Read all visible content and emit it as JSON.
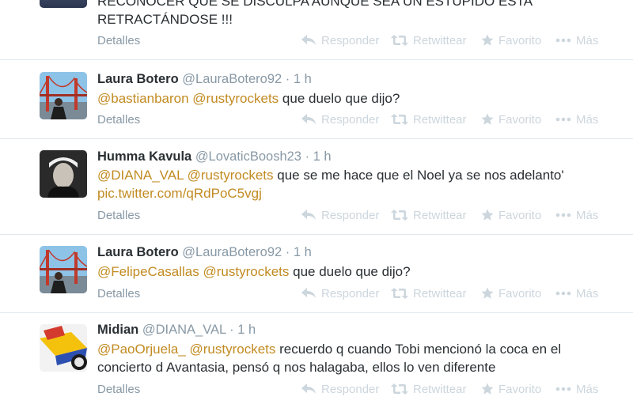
{
  "colors": {
    "mention": "#c28b22",
    "muted": "#8899a6",
    "action": "#ccd6dd",
    "divider": "#e1e8ed"
  },
  "actions": {
    "reply": "Responder",
    "retweet": "Retwittear",
    "favorite": "Favorito",
    "more": "Más",
    "details": "Detalles"
  },
  "tweets": [
    {
      "text_line1": "RECONOCER QUE SE DISCULPA AUNQUE SEA UN ESTUPIDO ESTA",
      "text_line2": "RETRACTÁNDOSE !!!"
    },
    {
      "name": "Laura Botero",
      "handle": "@LauraBotero92",
      "sep": "·",
      "time": "1 h",
      "mention1": "@bastianbaron",
      "mention2": "@rustyrockets",
      "text": " que duelo que dijo?",
      "avatar_icon": "profile-photo-bridge"
    },
    {
      "name": "Humma Kavula",
      "handle": "@LovaticBoosh23",
      "sep": "·",
      "time": "1 h",
      "mention1": "@DIANA_VAL",
      "mention2": "@rustyrockets",
      "text": " que se me hace que el Noel ya se nos adelanto'",
      "link": "pic.twitter.com/qRdPoC5vgj",
      "avatar_icon": "profile-photo-person"
    },
    {
      "name": "Laura Botero",
      "handle": "@LauraBotero92",
      "sep": "·",
      "time": "1 h",
      "mention1": "@FelipeCasallas",
      "mention2": "@rustyrockets",
      "text": " que duelo que dijo?",
      "avatar_icon": "profile-photo-bridge"
    },
    {
      "name": "Midian",
      "handle": "@DIANA_VAL",
      "sep": "·",
      "time": "1 h",
      "mention1": "@PaoOrjuela_",
      "mention2": "@rustyrockets",
      "text_line1": " recuerdo q cuando Tobi mencionó la coca en el",
      "text_line2": "concierto d Avantasia, pensó q nos halagaba, ellos lo ven diferente",
      "avatar_icon": "profile-photo-flag"
    }
  ]
}
